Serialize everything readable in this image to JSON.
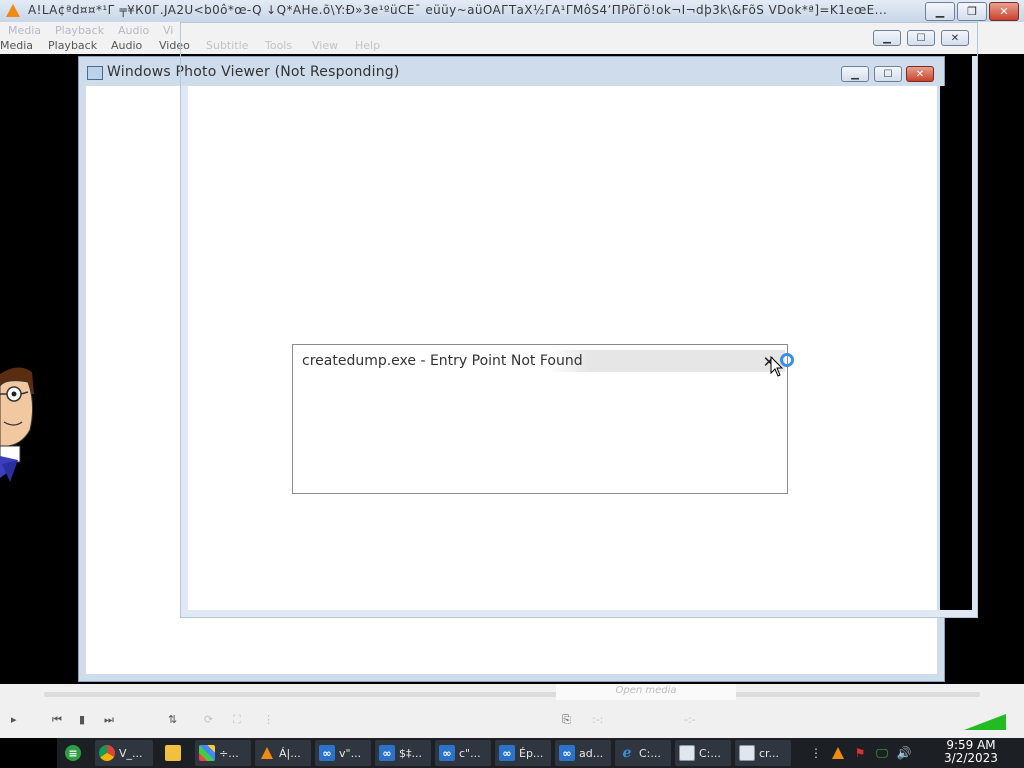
{
  "vlc": {
    "title": "A!LA¢ªd¤¤*¹Г ╤¥К0Г.JA2U<b0ô*œ-Q  ↓Q*AHe.õ\\Y:Ð»3e¹ºüCE¯ eüüy~aüOAГТaX½ΓA¹ΓМôS4ʼΠPöΓö!ok¬Ι¬dþ3k\\&FõS  VDok*ª]=K1eœE...",
    "menu": [
      "Media",
      "Playback",
      "Audio",
      "Video",
      "Subtitle",
      "Tools",
      "View",
      "Help"
    ],
    "ghost_menu": [
      "Media",
      "Playback",
      "Audio",
      "Vi"
    ],
    "open_media_hint": "Open media",
    "colors": {
      "accent_orange": "#f08a10",
      "volume_green": "#22bb22"
    }
  },
  "photo_viewer": {
    "title": "Windows Photo Viewer (Not Responding)"
  },
  "dialog": {
    "title": "createdump.exe - Entry Point Not Found",
    "close_glyph": "✕"
  },
  "taskbar": {
    "items": [
      {
        "icon": "app-icon",
        "label": ""
      },
      {
        "icon": "chrome-icon",
        "label": "V_..."
      },
      {
        "icon": "folder-icon",
        "label": ""
      },
      {
        "icon": "multi-icon",
        "label": "÷..."
      },
      {
        "icon": "vlc-icon",
        "label": "Á|..."
      },
      {
        "icon": "vs-icon",
        "label": "v\"..."
      },
      {
        "icon": "vs-icon",
        "label": "$‡..."
      },
      {
        "icon": "vs-icon",
        "label": "c\"..."
      },
      {
        "icon": "vs-icon",
        "label": "Ép..."
      },
      {
        "icon": "vs-icon",
        "label": "ad..."
      },
      {
        "icon": "ie-icon",
        "label": "C:..."
      },
      {
        "icon": "window-icon",
        "label": "C:..."
      },
      {
        "icon": "window-icon",
        "label": "cr..."
      }
    ],
    "clock_time": "9:59 AM",
    "clock_date": "3/2/2023"
  }
}
